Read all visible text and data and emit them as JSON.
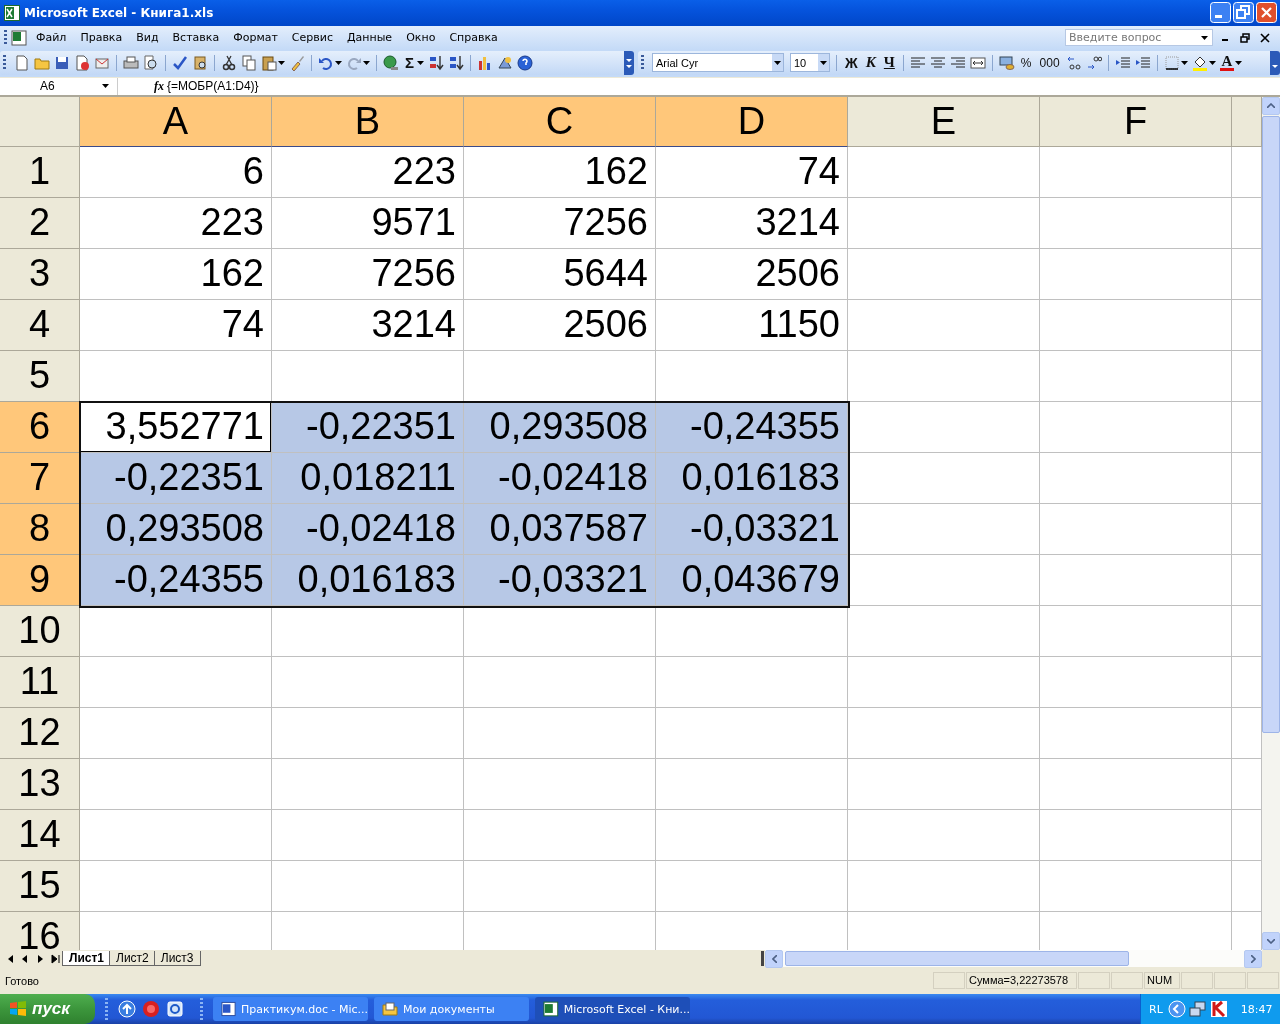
{
  "window": {
    "title": "Microsoft Excel - Книга1.xls"
  },
  "menu": {
    "items": [
      "Файл",
      "Правка",
      "Вид",
      "Вставка",
      "Формат",
      "Сервис",
      "Данные",
      "Окно",
      "Справка"
    ],
    "help_box": {
      "placeholder": "Введите вопрос"
    }
  },
  "standard_toolbar": {
    "sum_button": "Σ"
  },
  "formatting_toolbar": {
    "font": "Arial Cyr",
    "size": "10",
    "bold": "Ж",
    "italic": "К",
    "underline": "Ч",
    "percent": "%",
    "thousands": "000",
    "font_color": "A"
  },
  "formula_bar": {
    "name_box": "A6",
    "fx": "fx",
    "formula": "{=МОБР(A1:D4)}"
  },
  "sheet": {
    "columns": [
      {
        "label": "A",
        "selected": true
      },
      {
        "label": "B",
        "selected": true
      },
      {
        "label": "C",
        "selected": true
      },
      {
        "label": "D",
        "selected": true
      },
      {
        "label": "E",
        "selected": false
      },
      {
        "label": "F",
        "selected": false
      }
    ],
    "rows": [
      {
        "label": "1",
        "selected": false,
        "cells": [
          {
            "value": "6",
            "selected": false,
            "active": false
          },
          {
            "value": "223",
            "selected": false,
            "active": false
          },
          {
            "value": "162",
            "selected": false,
            "active": false
          },
          {
            "value": "74",
            "selected": false,
            "active": false
          }
        ]
      },
      {
        "label": "2",
        "selected": false,
        "cells": [
          {
            "value": "223",
            "selected": false,
            "active": false
          },
          {
            "value": "9571",
            "selected": false,
            "active": false
          },
          {
            "value": "7256",
            "selected": false,
            "active": false
          },
          {
            "value": "3214",
            "selected": false,
            "active": false
          }
        ]
      },
      {
        "label": "3",
        "selected": false,
        "cells": [
          {
            "value": "162",
            "selected": false,
            "active": false
          },
          {
            "value": "7256",
            "selected": false,
            "active": false
          },
          {
            "value": "5644",
            "selected": false,
            "active": false
          },
          {
            "value": "2506",
            "selected": false,
            "active": false
          }
        ]
      },
      {
        "label": "4",
        "selected": false,
        "cells": [
          {
            "value": "74",
            "selected": false,
            "active": false
          },
          {
            "value": "3214",
            "selected": false,
            "active": false
          },
          {
            "value": "2506",
            "selected": false,
            "active": false
          },
          {
            "value": "1150",
            "selected": false,
            "active": false
          }
        ]
      },
      {
        "label": "5",
        "selected": false,
        "cells": []
      },
      {
        "label": "6",
        "selected": true,
        "cells": [
          {
            "value": "3,552771",
            "selected": true,
            "active": true
          },
          {
            "value": "-0,22351",
            "selected": true,
            "active": false
          },
          {
            "value": "0,293508",
            "selected": true,
            "active": false
          },
          {
            "value": "-0,24355",
            "selected": true,
            "active": false
          }
        ]
      },
      {
        "label": "7",
        "selected": true,
        "cells": [
          {
            "value": "-0,22351",
            "selected": true,
            "active": false
          },
          {
            "value": "0,018211",
            "selected": true,
            "active": false
          },
          {
            "value": "-0,02418",
            "selected": true,
            "active": false
          },
          {
            "value": "0,016183",
            "selected": true,
            "active": false
          }
        ]
      },
      {
        "label": "8",
        "selected": true,
        "cells": [
          {
            "value": "0,293508",
            "selected": true,
            "active": false
          },
          {
            "value": "-0,02418",
            "selected": true,
            "active": false
          },
          {
            "value": "0,037587",
            "selected": true,
            "active": false
          },
          {
            "value": "-0,03321",
            "selected": true,
            "active": false
          }
        ]
      },
      {
        "label": "9",
        "selected": true,
        "cells": [
          {
            "value": "-0,24355",
            "selected": true,
            "active": false
          },
          {
            "value": "0,016183",
            "selected": true,
            "active": false
          },
          {
            "value": "-0,03321",
            "selected": true,
            "active": false
          },
          {
            "value": "0,043679",
            "selected": true,
            "active": false
          }
        ]
      },
      {
        "label": "10",
        "selected": false,
        "cells": []
      },
      {
        "label": "11",
        "selected": false,
        "cells": []
      },
      {
        "label": "12",
        "selected": false,
        "cells": []
      },
      {
        "label": "13",
        "selected": false,
        "cells": []
      },
      {
        "label": "14",
        "selected": false,
        "cells": []
      },
      {
        "label": "15",
        "selected": false,
        "cells": []
      },
      {
        "label": "16",
        "selected": false,
        "cells": []
      }
    ]
  },
  "sheet_tabs": [
    {
      "label": "Лист1",
      "selected": true
    },
    {
      "label": "Лист2",
      "selected": false
    },
    {
      "label": "Лист3",
      "selected": false
    }
  ],
  "status_bar": {
    "state": "Готово",
    "sum": "Сумма=3,22273578",
    "num": "NUM"
  },
  "taskbar": {
    "start": "пуск",
    "tasks": [
      {
        "label": "Практикум.doc - Mic...",
        "kind": "word",
        "selected": false
      },
      {
        "label": "Мои документы",
        "kind": "folder",
        "selected": false
      },
      {
        "label": "Microsoft Excel - Кни...",
        "kind": "excel",
        "selected": true
      }
    ],
    "language": "RL",
    "clock": "18:47"
  }
}
